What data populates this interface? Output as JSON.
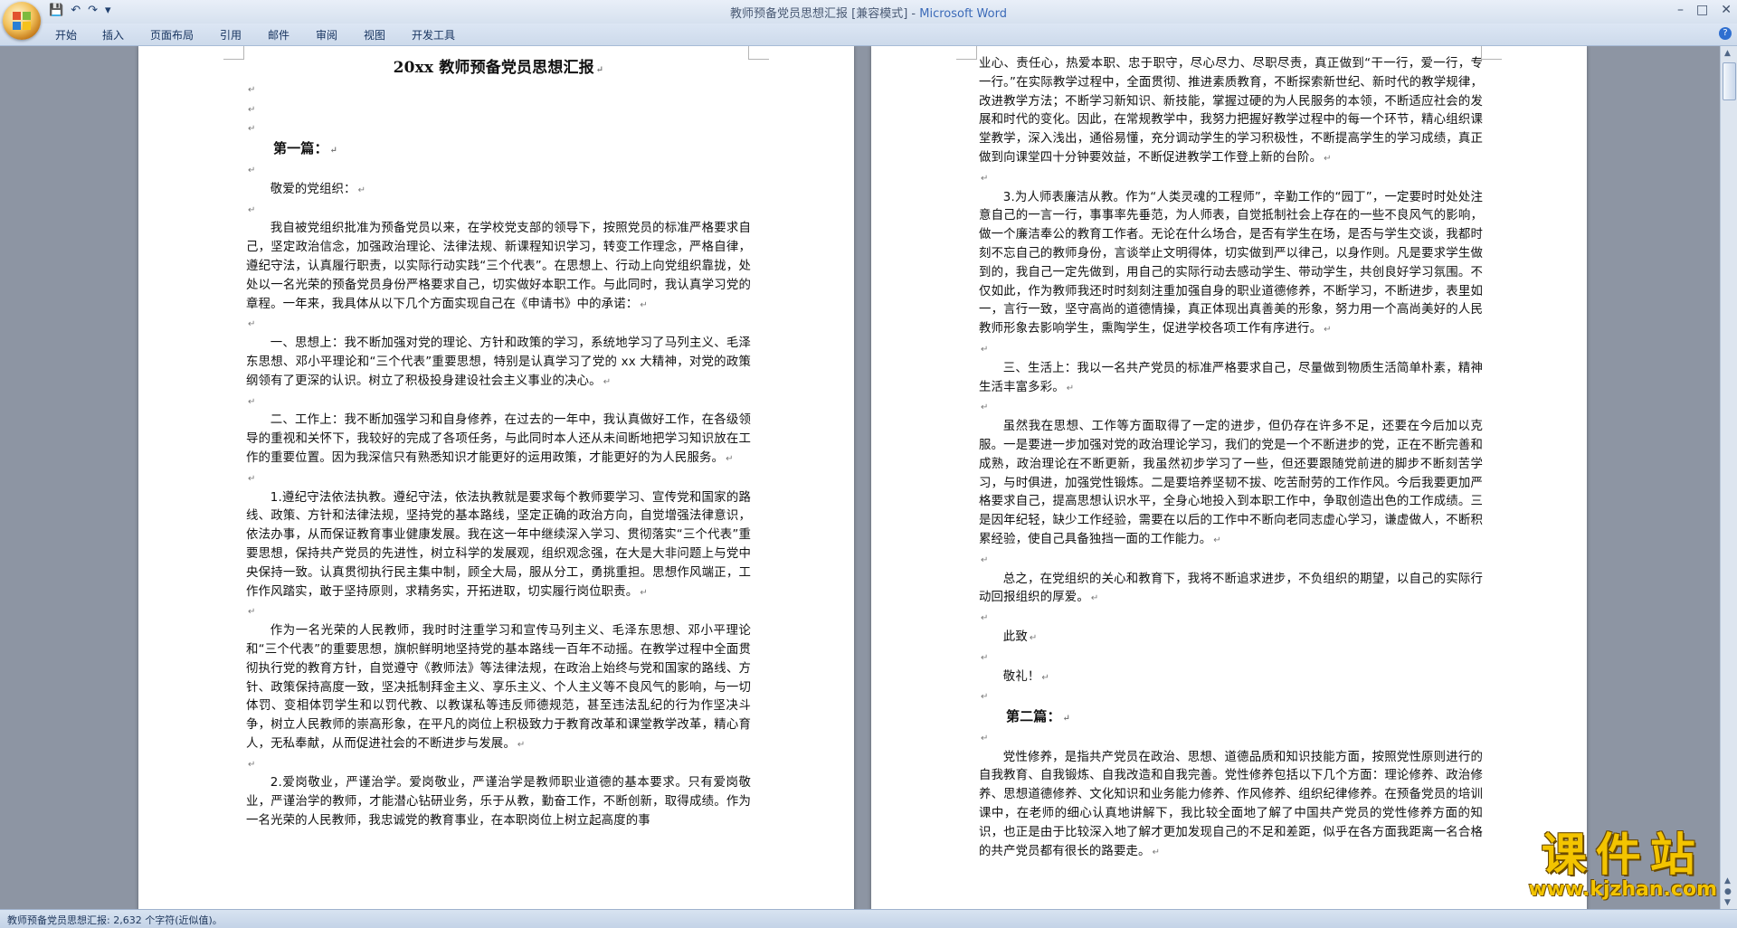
{
  "window": {
    "title": "教师预备党员思想汇报 [兼容模式] - ",
    "app_name": "Microsoft Word",
    "quick_access": [
      "save-icon",
      "undo-icon",
      "redo-icon",
      "customize-icon"
    ]
  },
  "ribbon": {
    "tabs": [
      "开始",
      "插入",
      "页面布局",
      "引用",
      "邮件",
      "审阅",
      "视图",
      "开发工具"
    ]
  },
  "page1": {
    "title": "20xx 教师预备党员思想汇报",
    "heading1": "第一篇：",
    "salutation": "敬爱的党组织：",
    "p1": "我自被党组织批准为预备党员以来，在学校党支部的领导下，按照党员的标准严格要求自己，坚定政治信念，加强政治理论、法律法规、新课程知识学习，转变工作理念，严格自律，遵纪守法，认真履行职责，以实际行动实践“三个代表”。在思想上、行动上向党组织靠拢，处处以一名光荣的预备党员身份严格要求自己，切实做好本职工作。与此同时，我认真学习党的章程。一年来，我具体从以下几个方面实现自己在《申请书》中的承诺：",
    "p2": "一、思想上：我不断加强对党的理论、方针和政策的学习，系统地学习了马列主义、毛泽东思想、邓小平理论和“三个代表”重要思想，特别是认真学习了党的 xx 大精神，对党的政策纲领有了更深的认识。树立了积极投身建设社会主义事业的决心。",
    "p3": "二、工作上：我不断加强学习和自身修养，在过去的一年中，我认真做好工作，在各级领导的重视和关怀下，我较好的完成了各项任务，与此同时本人还从未间断地把学习知识放在工作的重要位置。因为我深信只有熟悉知识才能更好的运用政策，才能更好的为人民服务。",
    "p4": "1.遵纪守法依法执教。遵纪守法，依法执教就是要求每个教师要学习、宣传党和国家的路线、政策、方针和法律法规，坚持党的基本路线，坚定正确的政治方向，自觉增强法律意识，依法办事，从而保证教育事业健康发展。我在这一年中继续深入学习、贯彻落实“三个代表”重要思想，保持共产党员的先进性，树立科学的发展观，组织观念强，在大是大非问题上与党中央保持一致。认真贯彻执行民主集中制，顾全大局，服从分工，勇挑重担。思想作风端正，工作作风踏实，敢于坚持原则，求精务实，开拓进取，切实履行岗位职责。",
    "p5": "作为一名光荣的人民教师，我时时注重学习和宣传马列主义、毛泽东思想、邓小平理论和“三个代表”的重要思想，旗帜鲜明地坚持党的基本路线一百年不动摇。在教学过程中全面贯彻执行党的教育方针，自觉遵守《教师法》等法律法规，在政治上始终与党和国家的路线、方针、政策保持高度一致，坚决抵制拜金主义、享乐主义、个人主义等不良风气的影响，与一切体罚、变相体罚学生和以罚代教、以教谋私等违反师德规范，甚至违法乱纪的行为作坚决斗争，树立人民教师的崇高形象，在平凡的岗位上积极致力于教育改革和课堂教学改革，精心育人，无私奉献，从而促进社会的不断进步与发展。",
    "p6": "2.爱岗敬业，严谨治学。爱岗敬业，严谨治学是教师职业道德的基本要求。只有爱岗敬业，严谨治学的教师，才能潜心钻研业务，乐于从教，勤奋工作，不断创新，取得成绩。作为一名光荣的人民教师，我忠诚党的教育事业，在本职岗位上树立起高度的事"
  },
  "page2": {
    "p1": "业心、责任心，热爱本职、忠于职守，尽心尽力、尽职尽责，真正做到“干一行，爱一行，专一行。”在实际教学过程中，全面贯彻、推进素质教育，不断探索新世纪、新时代的教学规律，改进教学方法；不断学习新知识、新技能，掌握过硬的为人民服务的本领，不断适应社会的发展和时代的变化。因此，在常规教学中，我努力把握好教学过程中的每一个环节，精心组织课堂教学，深入浅出，通俗易懂，充分调动学生的学习积极性，不断提高学生的学习成绩，真正做到向课堂四十分钟要效益，不断促进教学工作登上新的台阶。",
    "p2": "3.为人师表廉洁从教。作为“人类灵魂的工程师”，辛勤工作的“园丁”，一定要时时处处注意自己的一言一行，事事率先垂范，为人师表，自觉抵制社会上存在的一些不良风气的影响，做一个廉洁奉公的教育工作者。无论在什么场合，是否有学生在场，是否与学生交谈，我都时刻不忘自己的教师身份，言谈举止文明得体，切实做到严以律己，以身作则。凡是要求学生做到的，我自己一定先做到，用自己的实际行动去感动学生、带动学生，共创良好学习氛围。不仅如此，作为教师我还时时刻刻注重加强自身的职业道德修养，不断学习，不断进步，表里如一，言行一致，坚守高尚的道德情操，真正体现出真善美的形象，努力用一个高尚美好的人民教师形象去影响学生，熏陶学生，促进学校各项工作有序进行。",
    "p3": "三、生活上：我以一名共产党员的标准严格要求自己，尽量做到物质生活简单朴素，精神生活丰富多彩。",
    "p4": "虽然我在思想、工作等方面取得了一定的进步，但仍存在许多不足，还要在今后加以克服。一是要进一步加强对党的政治理论学习，我们的党是一个不断进步的党，正在不断完善和成熟，政治理论在不断更新，我虽然初步学习了一些，但还要跟随党前进的脚步不断刻苦学习，与时俱进，加强党性锻炼。二是要培养坚韧不拔、吃苦耐劳的工作作风。今后我要更加严格要求自己，提高思想认识水平，全身心地投入到本职工作中，争取创造出色的工作成绩。三是因年纪轻，缺少工作经验，需要在以后的工作中不断向老同志虚心学习，谦虚做人，不断积累经验，使自己具备独挡一面的工作能力。",
    "p5": "总之，在党组织的关心和教育下，我将不断追求进步，不负组织的期望，以自己的实际行动回报组织的厚爱。",
    "closing1": "此致",
    "closing2": "敬礼！",
    "heading2": "第二篇：",
    "p6": "党性修养，是指共产党员在政治、思想、道德品质和知识技能方面，按照党性原则进行的自我教育、自我锻炼、自我改造和自我完善。党性修养包括以下几个方面：理论修养、政治修养、思想道德修养、文化知识和业务能力修养、作风修养、组织纪律修养。在预备党员的培训课中，在老师的细心认真地讲解下，我比较全面地了解了中国共产党员的党性修养方面的知识，也正是由于比较深入地了解才更加发现自己的不足和差距，似乎在各方面我距离一名合格的共产党员都有很长的路要走。"
  },
  "paragraph_mark": "↵",
  "status": {
    "text": "教师预备党员思想汇报: 2,632 个字符(近似值)。"
  },
  "watermark": {
    "main": "课件站",
    "sub": "www.kjzhan.com"
  }
}
